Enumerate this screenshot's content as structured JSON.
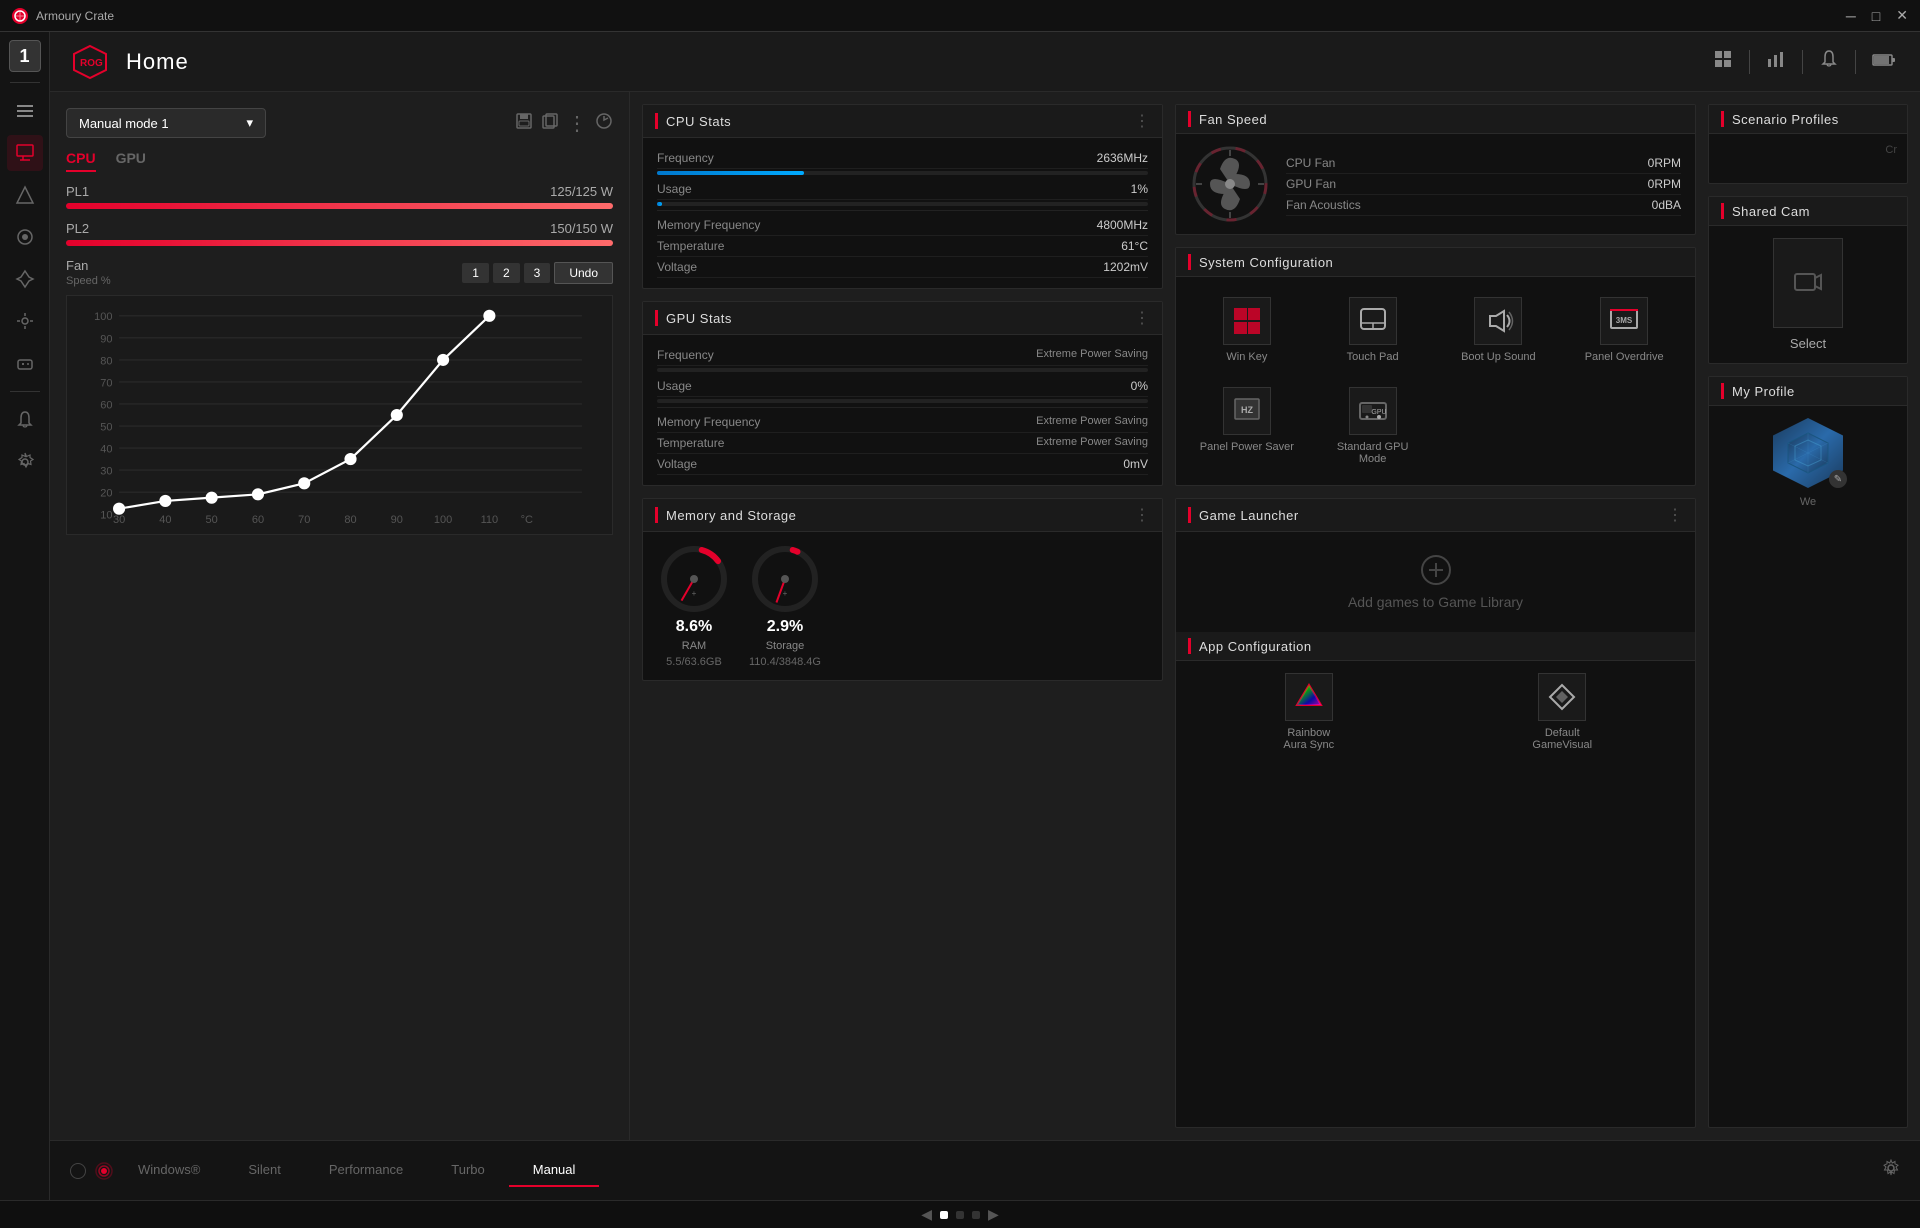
{
  "titleBar": {
    "appName": "Armoury Crate",
    "minBtn": "─",
    "maxBtn": "□",
    "closeBtn": "✕"
  },
  "header": {
    "title": "Home",
    "icons": [
      "⊞",
      "|",
      "📊",
      "|",
      "🔔",
      "|",
      "🔋"
    ]
  },
  "sidebar": {
    "items": [
      {
        "icon": "1",
        "name": "profile-number",
        "active": true
      },
      {
        "icon": "☰",
        "name": "menu"
      },
      {
        "icon": "⚙",
        "name": "devices"
      },
      {
        "icon": "✦",
        "name": "aura"
      },
      {
        "icon": "◈",
        "name": "armoury"
      },
      {
        "icon": "⚡",
        "name": "scenario"
      },
      {
        "icon": "⊹",
        "name": "settings-tools"
      },
      {
        "icon": "🎮",
        "name": "game"
      },
      {
        "icon": "↗",
        "name": "arrow"
      },
      {
        "icon": "☰",
        "name": "menu2"
      }
    ]
  },
  "leftPanel": {
    "modeDropdown": "Manual mode 1",
    "tabs": {
      "cpu": "CPU",
      "gpu": "GPU"
    },
    "pl1": {
      "label": "PL1",
      "value": "125/125 W"
    },
    "pl2": {
      "label": "PL2",
      "value": "150/150 W"
    },
    "fan": {
      "label": "Fan",
      "sublabel": "Speed %",
      "presets": [
        "1",
        "2",
        "3"
      ],
      "undoBtn": "Undo"
    },
    "chartYLabel": "Speed %",
    "chartXLabel": "°C",
    "chartTemps": [
      30,
      40,
      50,
      60,
      70,
      80,
      90,
      100,
      110
    ]
  },
  "cpuStats": {
    "title": "CPU Stats",
    "frequency": {
      "label": "Frequency",
      "value": "2636MHz"
    },
    "usage": {
      "label": "Usage",
      "value": "1%"
    },
    "memFreq": {
      "label": "Memory Frequency",
      "value": "4800MHz"
    },
    "temperature": {
      "label": "Temperature",
      "value": "61°C"
    },
    "voltage": {
      "label": "Voltage",
      "value": "1202mV"
    }
  },
  "gpuStats": {
    "title": "GPU Stats",
    "frequency": {
      "label": "Frequency",
      "value": "Extreme Power Saving"
    },
    "usage": {
      "label": "Usage",
      "value": "0%"
    },
    "memFreq": {
      "label": "Memory Frequency",
      "value": "Extreme Power Saving"
    },
    "temperature": {
      "label": "Temperature",
      "value": "Extreme Power Saving"
    },
    "voltage": {
      "label": "Voltage",
      "value": "0mV"
    }
  },
  "fanSpeed": {
    "title": "Fan Speed",
    "cpuFan": {
      "label": "CPU Fan",
      "value": "0RPM"
    },
    "gpuFan": {
      "label": "GPU Fan",
      "value": "0RPM"
    },
    "fanAcoustics": {
      "label": "Fan Acoustics",
      "value": "0dBA"
    }
  },
  "systemConfig": {
    "title": "System Configuration",
    "items": [
      {
        "icon": "⊞",
        "label": "Win Key",
        "name": "win-key"
      },
      {
        "icon": "⌨",
        "label": "Touch Pad",
        "name": "touch-pad"
      },
      {
        "icon": "🔊",
        "label": "Boot Up Sound",
        "name": "boot-up-sound"
      },
      {
        "icon": "📺",
        "label": "Panel Overdrive",
        "name": "panel-overdrive"
      },
      {
        "icon": "Hz",
        "label": "Panel Power Saver",
        "name": "panel-power-saver"
      },
      {
        "icon": "GPU",
        "label": "Standard GPU Mode",
        "name": "gpu-mode"
      }
    ]
  },
  "gameLauncher": {
    "title": "Game Launcher",
    "addGamesText": "Add games to Game Library"
  },
  "memoryStorage": {
    "title": "Memory and Storage",
    "ram": {
      "percentage": "8.6%",
      "label": "RAM",
      "value": "5.5/63.6GB"
    },
    "storage": {
      "percentage": "2.9%",
      "label": "Storage",
      "value": "110.4/3848.4G"
    }
  },
  "appConfig": {
    "title": "App Configuration",
    "items": [
      {
        "label": "Rainbow\nAura Sync",
        "name": "rainbow-aura-sync"
      },
      {
        "label": "Default\nGameVisual",
        "name": "default-game-visual"
      }
    ]
  },
  "scenarioProfiles": {
    "title": "Scenario Profiles"
  },
  "sharedCam": {
    "title": "Shared Cam",
    "selectBtn": "Select"
  },
  "myProfile": {
    "title": "My Profile",
    "editLabel": "We"
  },
  "bottomModes": {
    "tabs": [
      {
        "label": "Windows®",
        "active": false
      },
      {
        "label": "Silent",
        "active": false
      },
      {
        "label": "Performance",
        "active": false
      },
      {
        "label": "Turbo",
        "active": false
      },
      {
        "label": "Manual",
        "active": true
      }
    ]
  },
  "colors": {
    "accent": "#e4002b",
    "accentBlue": "#0088cc",
    "bg": "#1a1a1a",
    "cardBg": "#111111",
    "border": "#2a2a2a"
  }
}
